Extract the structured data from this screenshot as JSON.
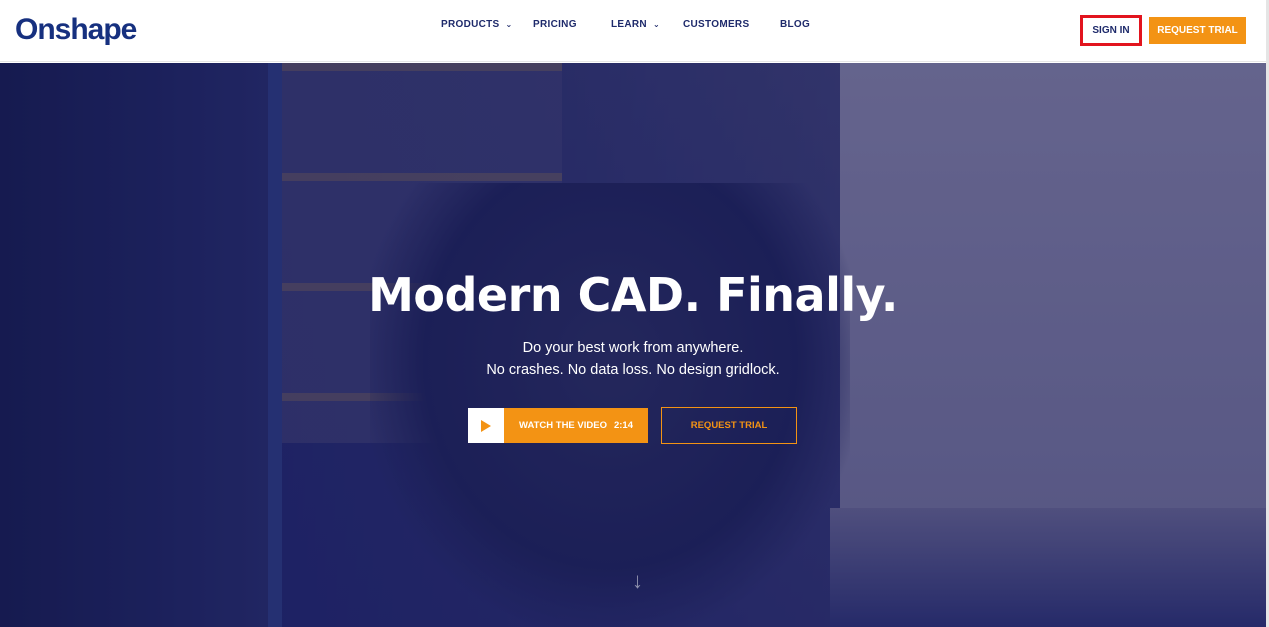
{
  "brand": {
    "logo_text": "Onshape",
    "color": "#16307f",
    "accent": "#f39314",
    "highlight": "#e2141e"
  },
  "nav": {
    "products": "PRODUCTS",
    "pricing": "PRICING",
    "learn": "LEARN",
    "customers": "CUSTOMERS",
    "blog": "BLOG",
    "chevron": "⌄"
  },
  "header_actions": {
    "sign_in": "SIGN IN",
    "request_trial": "REQUEST TRIAL"
  },
  "hero": {
    "title": "Modern CAD. Finally.",
    "subtitle_line1": "Do your best work from anywhere.",
    "subtitle_line2": "No crashes. No data loss. No design gridlock.",
    "watch_label": "WATCH THE VIDEO",
    "watch_duration": "2:14",
    "request_trial": "REQUEST TRIAL",
    "scroll_icon": "↓"
  }
}
